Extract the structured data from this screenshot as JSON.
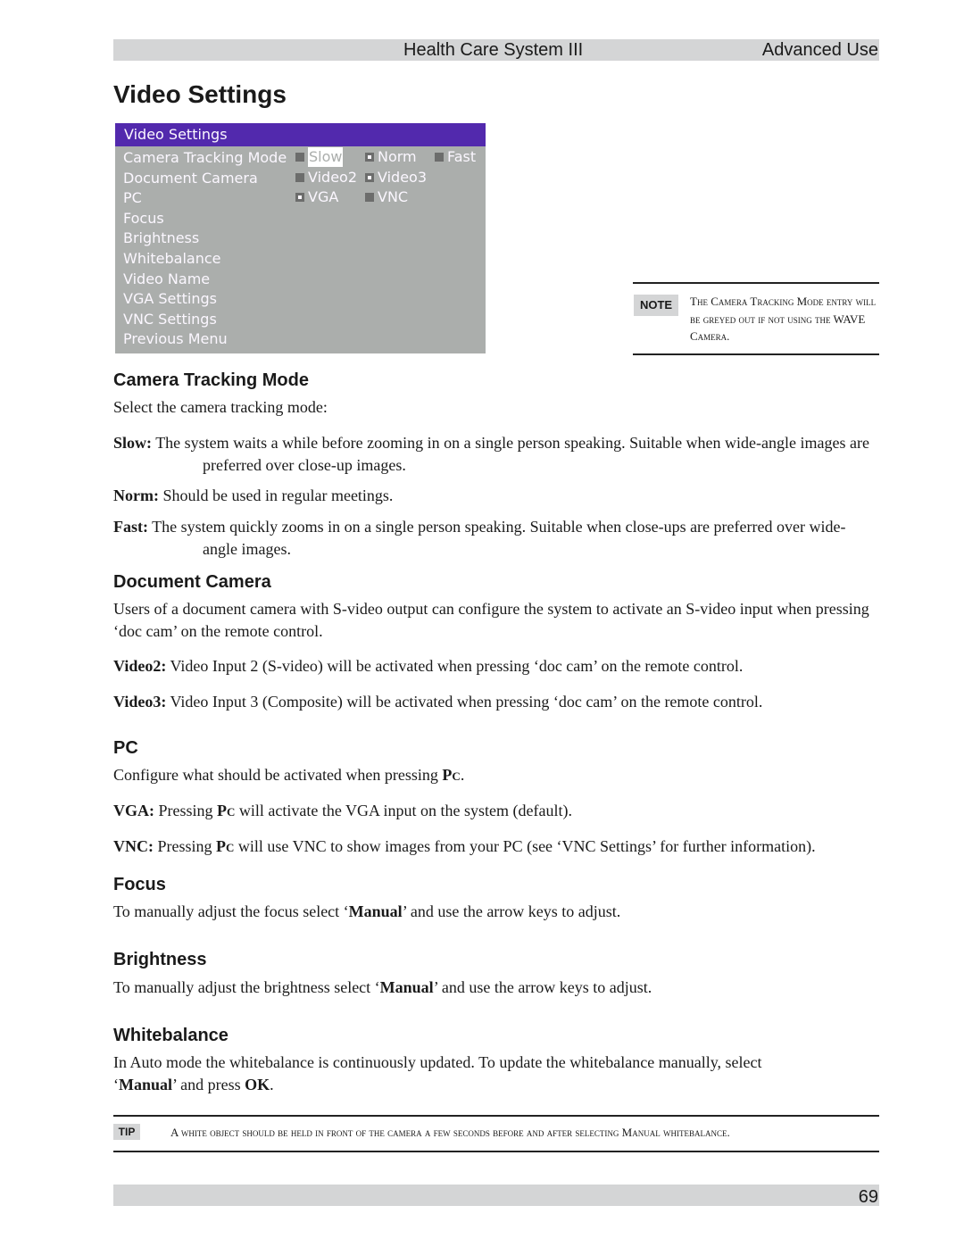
{
  "header": {
    "title": "Health Care System III",
    "section": "Advanced Use"
  },
  "page_title": "Video Settings",
  "osd": {
    "title": "Video Settings",
    "colors": {
      "titlebar": "#5229ad",
      "background": "#abaeac",
      "text": "#fbf7ff"
    },
    "menu_items": [
      "Camera Tracking Mode",
      "Document Camera",
      "PC",
      "Focus",
      "Brightness",
      "Whitebalance",
      "Video Name",
      "VGA Settings",
      "VNC Settings",
      "Previous Menu"
    ],
    "camera_tracking_options": [
      {
        "label": "Slow",
        "checked": false,
        "highlighted": true
      },
      {
        "label": "Norm",
        "checked": true,
        "highlighted": false
      },
      {
        "label": "Fast",
        "checked": false,
        "highlighted": false
      }
    ],
    "document_camera_options": [
      {
        "label": "Video2",
        "checked": false
      },
      {
        "label": "Video3",
        "checked": true
      }
    ],
    "pc_options": [
      {
        "label": "VGA",
        "checked": true
      },
      {
        "label": "VNC",
        "checked": false
      }
    ]
  },
  "note": {
    "badge": "NOTE",
    "text": "The Camera Tracking Mode entry will be greyed out if not using the WAVE Camera."
  },
  "sections": {
    "camera_tracking": {
      "heading": "Camera Tracking Mode",
      "intro": "Select the camera tracking mode:",
      "items": [
        {
          "term": "Slow:",
          "text": " The system waits a while before zooming in on a single person speaking. Suitable when wide-angle images are preferred over close-up images."
        },
        {
          "term": "Norm:",
          "text": " Should be used in regular meetings."
        },
        {
          "term": "Fast:",
          "text": " The system quickly zooms in on a single person speaking. Suitable when close-ups are preferred over wide-angle images."
        }
      ]
    },
    "document_camera": {
      "heading": "Document Camera",
      "intro": "Users of a document camera with S-video output can configure the system to activate an S-video input when pressing ‘doc cam’ on the remote control.",
      "items": [
        {
          "term": "Video2:",
          "text": " Video Input 2 (S-video) will be activated when pressing ‘doc cam’ on the remote control."
        },
        {
          "term": "Video3:",
          "text": " Video Input 3 (Composite) will be activated when pressing ‘doc cam’ on the remote control."
        }
      ]
    },
    "pc": {
      "heading": "PC",
      "intro_before": "Configure what should be activated when pressing ",
      "key": "Pc",
      "intro_after": ".",
      "items": [
        {
          "term": "VGA:",
          "before": " Pressing ",
          "key": "Pc",
          "after": " will activate the VGA input on the system (default)."
        },
        {
          "term": "VNC:",
          "before": " Pressing ",
          "key": "Pc",
          "after": " will use VNC to show images from your PC (see ‘VNC Settings’ for further information)."
        }
      ]
    },
    "focus": {
      "heading": "Focus",
      "before": "To manually adjust the focus select ‘",
      "bold": "Manual",
      "after": "’ and use the arrow keys to adjust."
    },
    "brightness": {
      "heading": "Brightness",
      "before": "To manually adjust the brightness select ‘",
      "bold": "Manual",
      "after": "’ and use the arrow keys to adjust."
    },
    "whitebalance": {
      "heading": "Whitebalance",
      "line1": "In Auto mode the whitebalance is continuously updated. To update the whitebalance manually, select",
      "line2_open": "‘",
      "bold1": "Manual",
      "line2_mid": "’ and press ",
      "bold2": "OK",
      "line2_end": "."
    }
  },
  "tip": {
    "badge": "TIP",
    "text": "A white object should be held in front of the camera a few seconds before and after selecting Manual whitebalance."
  },
  "footer": {
    "page_number": "69"
  }
}
